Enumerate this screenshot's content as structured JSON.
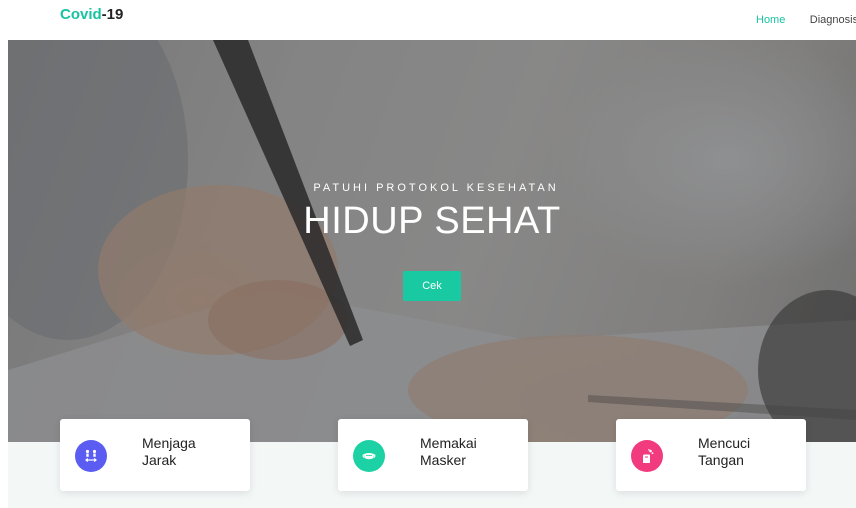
{
  "navbar": {
    "brand_main": "Covid",
    "brand_accent": "-19",
    "links": [
      {
        "label": "Home",
        "active": true
      },
      {
        "label": "Diagnosis",
        "active": false
      }
    ]
  },
  "hero": {
    "subtitle": "PATUHI PROTOKOL KESEHATAN",
    "title": "HIDUP SEHAT",
    "button_label": "Cek"
  },
  "features": [
    {
      "label": "Menjaga\nJarak",
      "icon": "social-distance-icon",
      "color": "#5a5cf2"
    },
    {
      "label": "Memakai\nMasker",
      "icon": "face-mask-icon",
      "color": "#1cd1a3"
    },
    {
      "label": "Mencuci\nTangan",
      "icon": "hand-wash-icon",
      "color": "#f23a7e"
    }
  ],
  "colors": {
    "accent": "#19c2a0",
    "button": "#19c9a1"
  }
}
